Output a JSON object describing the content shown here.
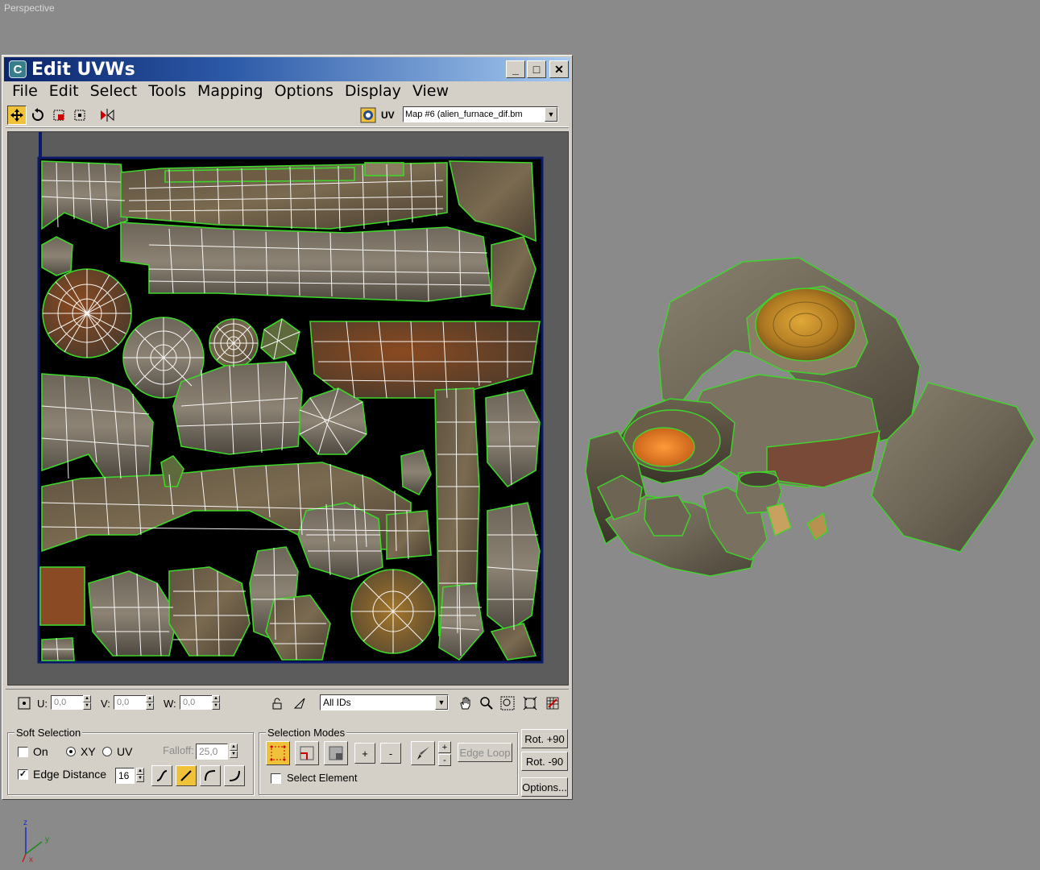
{
  "viewport": {
    "label": "Perspective"
  },
  "window": {
    "title": "Edit UVWs",
    "controls": {
      "minimize": "_",
      "maximize": "□",
      "close": "✕"
    }
  },
  "menu": [
    "File",
    "Edit",
    "Select",
    "Tools",
    "Mapping",
    "Options",
    "Display",
    "View"
  ],
  "toolbar": {
    "uv_label": "UV",
    "map_select": "Map #6 (alien_furnace_dif.bm"
  },
  "coords": {
    "u_label": "U:",
    "u_value": "0,0",
    "v_label": "V:",
    "v_value": "0,0",
    "w_label": "W:",
    "w_value": "0,0",
    "ids_select": "All IDs"
  },
  "soft_selection": {
    "title": "Soft Selection",
    "on_label": "On",
    "xy_label": "XY",
    "uv_label": "UV",
    "falloff_label": "Falloff:",
    "falloff_value": "25,0",
    "edge_distance_label": "Edge Distance",
    "edge_distance_value": "16"
  },
  "selection_modes": {
    "title": "Selection Modes",
    "plus": "+",
    "minus": "-",
    "edge_loop": "Edge Loop",
    "select_element": "Select Element"
  },
  "rotate": {
    "rot_plus": "Rot. +90",
    "rot_minus": "Rot. -90",
    "options": "Options..."
  },
  "axis": {
    "x": "x",
    "y": "y",
    "z": "z"
  },
  "colors": {
    "accent": "#f0c23a",
    "uv_seam": "#3ed62a",
    "uv_wire": "#ffffff",
    "title_start": "#0a246a",
    "title_end": "#a6caf0"
  }
}
